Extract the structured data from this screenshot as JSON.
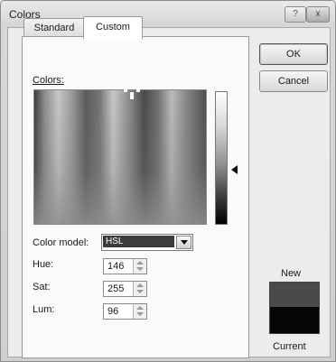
{
  "window": {
    "title": "Colors",
    "help_label": "?",
    "close_label": "x"
  },
  "tabs": [
    {
      "label": "Standard",
      "active": false
    },
    {
      "label": "Custom",
      "active": true
    }
  ],
  "custom": {
    "colors_label": "Colors:",
    "color_model": {
      "label": "Color model:",
      "value": "HSL",
      "options_visible": [
        "HSL"
      ]
    },
    "fields": [
      {
        "label": "Hue:",
        "value": "146"
      },
      {
        "label": "Sat:",
        "value": "255"
      },
      {
        "label": "Lum:",
        "value": "96"
      }
    ],
    "lum_slider_level": 0.59
  },
  "buttons": {
    "ok_label": "OK",
    "cancel_label": "Cancel"
  },
  "preview": {
    "new_label": "New",
    "current_label": "Current",
    "new_color": "#4a4a4a",
    "current_color": "#050505"
  }
}
